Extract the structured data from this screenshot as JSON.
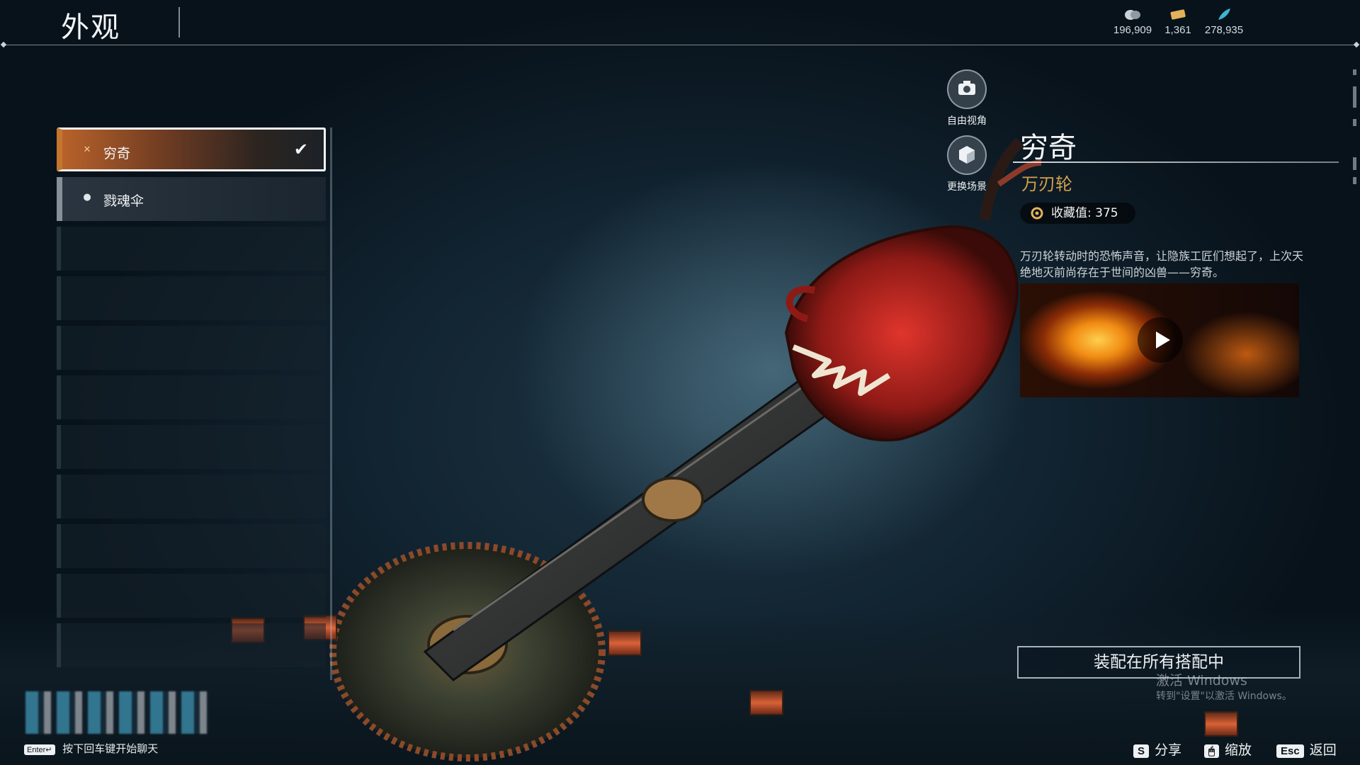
{
  "header": {
    "title": "外观"
  },
  "currencies": [
    {
      "icon": "coin-bag-icon",
      "value": "196,909"
    },
    {
      "icon": "ticket-icon",
      "value": "1,361"
    },
    {
      "icon": "feather-icon",
      "value": "278,935"
    }
  ],
  "skin_list": {
    "items": [
      {
        "label": "穷奇",
        "icon": "crossed-blades-icon",
        "selected": true
      },
      {
        "label": "戮魂伞",
        "icon": "droplet-icon",
        "selected": false
      }
    ]
  },
  "view_controls": {
    "free_camera": "自由视角",
    "change_scene": "更换场景"
  },
  "detail": {
    "name": "穷奇",
    "type": "万刃轮",
    "collection_label": "收藏值: 375",
    "description": "万刃轮转动时的恐怖声音，让隐族工匠们想起了，上次天绝地灭前尚存在于世间的凶兽——穷奇。"
  },
  "equip_button": "装配在所有搭配中",
  "watermark": {
    "line1": "激活 Windows",
    "line2": "转到\"设置\"以激活 Windows。"
  },
  "chat": {
    "key": "Enter↵",
    "text": "按下回车键开始聊天"
  },
  "hints": [
    {
      "key": "S",
      "label": "分享"
    },
    {
      "key": "🖱",
      "label": "缩放"
    },
    {
      "key": "Esc",
      "label": "返回"
    }
  ],
  "colors": {
    "accent": "#c5762e",
    "type_gold": "#d2a04d"
  }
}
